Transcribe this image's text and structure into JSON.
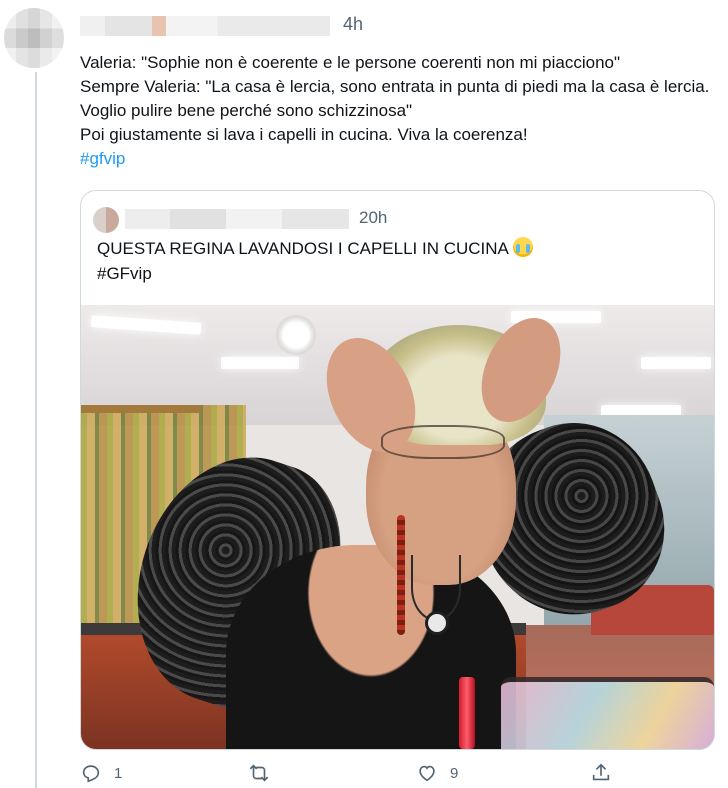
{
  "tweet": {
    "time": "4h",
    "lines": [
      "Valeria: \"Sophie non è coerente e le persone coerenti non mi piacciono\"",
      "Sempre Valeria: \"La casa è lercia, sono entrata in punta di piedi ma la casa è lercia. Voglio pulire bene perché sono schizzinosa\"",
      "Poi giustamente si lava i capelli in cucina. Viva la coerenza!"
    ],
    "hashtag": "#gfvip"
  },
  "quoted": {
    "time": "20h",
    "text": "QUESTA REGINA LAVANDOSI I CAPELLI IN CUCINA",
    "emoji": "loudly-crying-face-emoji",
    "hashtag": "#GFvip"
  },
  "actions": {
    "reply_count": "1",
    "retweet_count": "",
    "like_count": "9",
    "icons": [
      "reply-icon",
      "retweet-icon",
      "like-icon",
      "share-icon"
    ]
  },
  "colors": {
    "hashtag": "#1d9bf0",
    "secondary_text": "#536471",
    "border": "#cfd9de"
  }
}
